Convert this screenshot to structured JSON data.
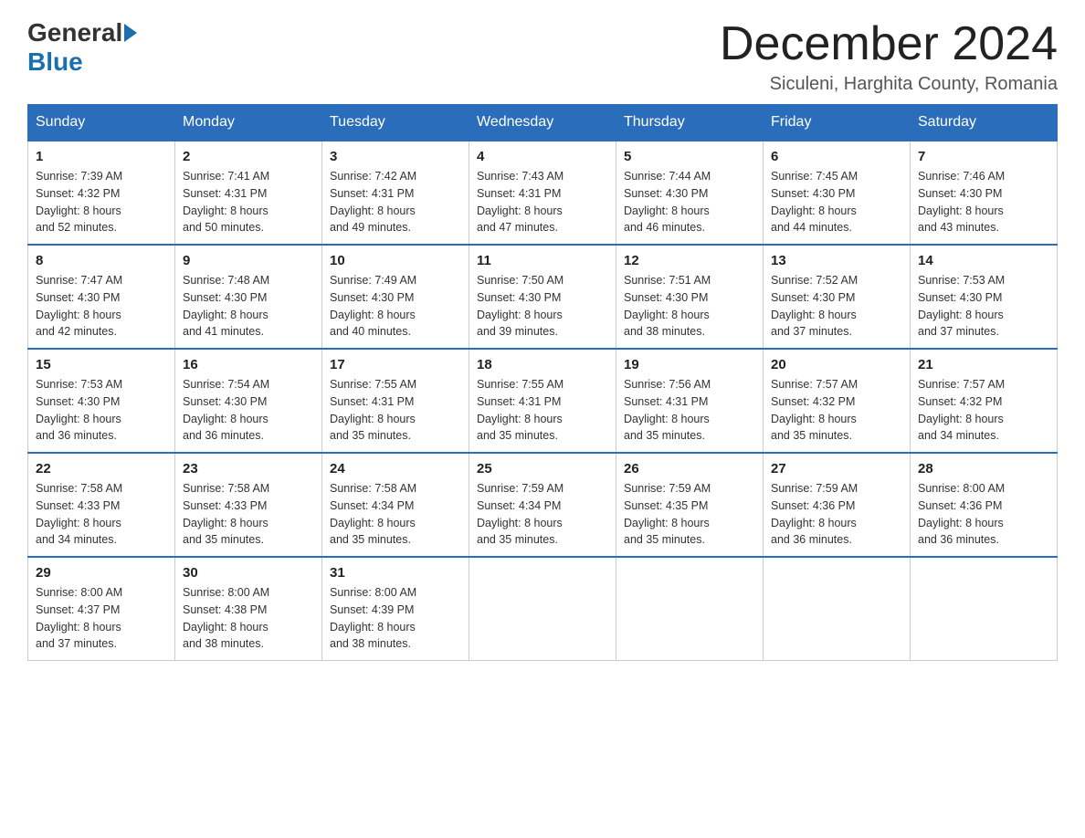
{
  "header": {
    "logo_general": "General",
    "logo_blue": "Blue",
    "month_title": "December 2024",
    "location": "Siculeni, Harghita County, Romania"
  },
  "weekdays": [
    "Sunday",
    "Monday",
    "Tuesday",
    "Wednesday",
    "Thursday",
    "Friday",
    "Saturday"
  ],
  "weeks": [
    [
      {
        "day": "1",
        "sunrise": "7:39 AM",
        "sunset": "4:32 PM",
        "daylight": "8 hours and 52 minutes."
      },
      {
        "day": "2",
        "sunrise": "7:41 AM",
        "sunset": "4:31 PM",
        "daylight": "8 hours and 50 minutes."
      },
      {
        "day": "3",
        "sunrise": "7:42 AM",
        "sunset": "4:31 PM",
        "daylight": "8 hours and 49 minutes."
      },
      {
        "day": "4",
        "sunrise": "7:43 AM",
        "sunset": "4:31 PM",
        "daylight": "8 hours and 47 minutes."
      },
      {
        "day": "5",
        "sunrise": "7:44 AM",
        "sunset": "4:30 PM",
        "daylight": "8 hours and 46 minutes."
      },
      {
        "day": "6",
        "sunrise": "7:45 AM",
        "sunset": "4:30 PM",
        "daylight": "8 hours and 44 minutes."
      },
      {
        "day": "7",
        "sunrise": "7:46 AM",
        "sunset": "4:30 PM",
        "daylight": "8 hours and 43 minutes."
      }
    ],
    [
      {
        "day": "8",
        "sunrise": "7:47 AM",
        "sunset": "4:30 PM",
        "daylight": "8 hours and 42 minutes."
      },
      {
        "day": "9",
        "sunrise": "7:48 AM",
        "sunset": "4:30 PM",
        "daylight": "8 hours and 41 minutes."
      },
      {
        "day": "10",
        "sunrise": "7:49 AM",
        "sunset": "4:30 PM",
        "daylight": "8 hours and 40 minutes."
      },
      {
        "day": "11",
        "sunrise": "7:50 AM",
        "sunset": "4:30 PM",
        "daylight": "8 hours and 39 minutes."
      },
      {
        "day": "12",
        "sunrise": "7:51 AM",
        "sunset": "4:30 PM",
        "daylight": "8 hours and 38 minutes."
      },
      {
        "day": "13",
        "sunrise": "7:52 AM",
        "sunset": "4:30 PM",
        "daylight": "8 hours and 37 minutes."
      },
      {
        "day": "14",
        "sunrise": "7:53 AM",
        "sunset": "4:30 PM",
        "daylight": "8 hours and 37 minutes."
      }
    ],
    [
      {
        "day": "15",
        "sunrise": "7:53 AM",
        "sunset": "4:30 PM",
        "daylight": "8 hours and 36 minutes."
      },
      {
        "day": "16",
        "sunrise": "7:54 AM",
        "sunset": "4:30 PM",
        "daylight": "8 hours and 36 minutes."
      },
      {
        "day": "17",
        "sunrise": "7:55 AM",
        "sunset": "4:31 PM",
        "daylight": "8 hours and 35 minutes."
      },
      {
        "day": "18",
        "sunrise": "7:55 AM",
        "sunset": "4:31 PM",
        "daylight": "8 hours and 35 minutes."
      },
      {
        "day": "19",
        "sunrise": "7:56 AM",
        "sunset": "4:31 PM",
        "daylight": "8 hours and 35 minutes."
      },
      {
        "day": "20",
        "sunrise": "7:57 AM",
        "sunset": "4:32 PM",
        "daylight": "8 hours and 35 minutes."
      },
      {
        "day": "21",
        "sunrise": "7:57 AM",
        "sunset": "4:32 PM",
        "daylight": "8 hours and 34 minutes."
      }
    ],
    [
      {
        "day": "22",
        "sunrise": "7:58 AM",
        "sunset": "4:33 PM",
        "daylight": "8 hours and 34 minutes."
      },
      {
        "day": "23",
        "sunrise": "7:58 AM",
        "sunset": "4:33 PM",
        "daylight": "8 hours and 35 minutes."
      },
      {
        "day": "24",
        "sunrise": "7:58 AM",
        "sunset": "4:34 PM",
        "daylight": "8 hours and 35 minutes."
      },
      {
        "day": "25",
        "sunrise": "7:59 AM",
        "sunset": "4:34 PM",
        "daylight": "8 hours and 35 minutes."
      },
      {
        "day": "26",
        "sunrise": "7:59 AM",
        "sunset": "4:35 PM",
        "daylight": "8 hours and 35 minutes."
      },
      {
        "day": "27",
        "sunrise": "7:59 AM",
        "sunset": "4:36 PM",
        "daylight": "8 hours and 36 minutes."
      },
      {
        "day": "28",
        "sunrise": "8:00 AM",
        "sunset": "4:36 PM",
        "daylight": "8 hours and 36 minutes."
      }
    ],
    [
      {
        "day": "29",
        "sunrise": "8:00 AM",
        "sunset": "4:37 PM",
        "daylight": "8 hours and 37 minutes."
      },
      {
        "day": "30",
        "sunrise": "8:00 AM",
        "sunset": "4:38 PM",
        "daylight": "8 hours and 38 minutes."
      },
      {
        "day": "31",
        "sunrise": "8:00 AM",
        "sunset": "4:39 PM",
        "daylight": "8 hours and 38 minutes."
      },
      null,
      null,
      null,
      null
    ]
  ],
  "labels": {
    "sunrise": "Sunrise:",
    "sunset": "Sunset:",
    "daylight": "Daylight:"
  }
}
